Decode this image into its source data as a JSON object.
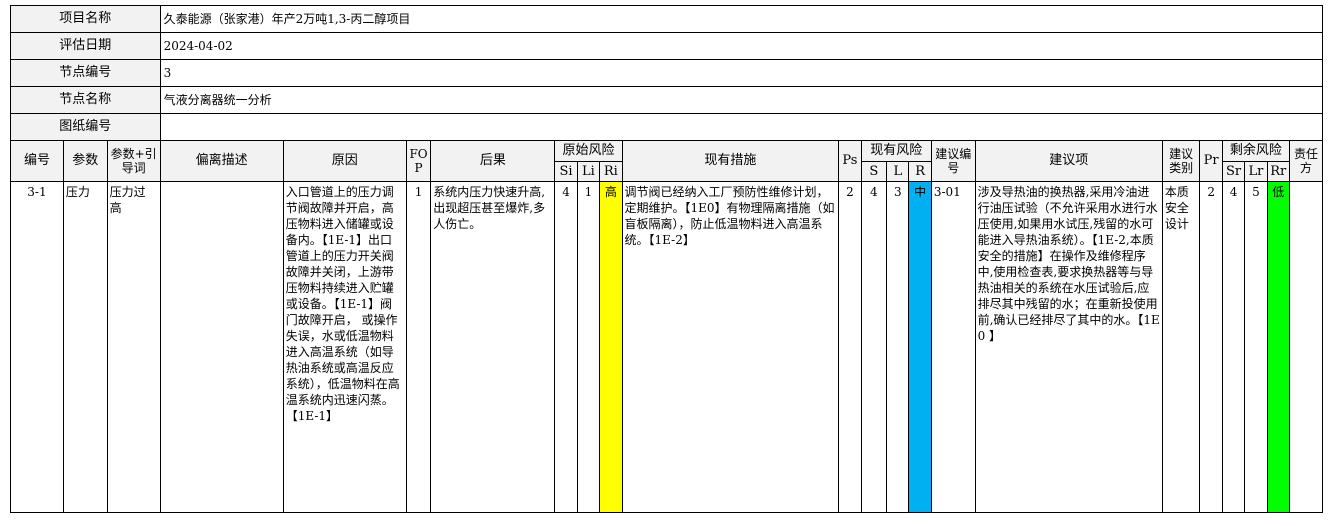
{
  "info": {
    "project_name_label": "项目名称",
    "project_name": "久泰能源（张家港）年产2万吨1,3-丙二醇项目",
    "eval_date_label": "评估日期",
    "eval_date": "2024-04-02",
    "node_no_label": "节点编号",
    "node_no": "3",
    "node_name_label": "节点名称",
    "node_name": "气液分离器统一分析",
    "drawing_no_label": "图纸编号",
    "drawing_no": ""
  },
  "headers": {
    "no": "编号",
    "param": "参数",
    "param_guide": "参数+引导词",
    "deviation": "偏离描述",
    "cause": "原因",
    "fop": "FOP",
    "consequence": "后果",
    "orig_risk": "原始风险",
    "si": "Si",
    "li": "Li",
    "ri": "Ri",
    "measures": "现有措施",
    "ps": "Ps",
    "cur_risk": "现有风险",
    "s": "S",
    "l": "L",
    "r": "R",
    "sugg_no": "建议编号",
    "sugg": "建议项",
    "sugg_type": "建议类别",
    "pr": "Pr",
    "residual_risk": "剩余风险",
    "sr": "Sr",
    "lr": "Lr",
    "rr": "Rr",
    "owner": "责任方"
  },
  "row": {
    "no": "3-1",
    "param": "压力",
    "param_guide": "压力过高",
    "deviation": "",
    "cause": "入口管道上的压力调节阀故障并开启，高压物料进入储罐或设备内。【1E-1】出口管道上的压力开关阀故障并关闭，上游带压物料持续进入贮罐或设备。【1E-1】阀门故障开启， 或操作失误，水或低温物料进入高温系统（如导热油系统或高温反应系统），低温物料在高温系统内迅速闪蒸。【1E-1】",
    "fop": "1",
    "consequence": "系统内压力快速升高,出现超压甚至爆炸,多人伤亡。",
    "si": "4",
    "li": "1",
    "ri": "高",
    "measures": "调节阀已经纳入工厂预防性维修计划，定期维护。【1E0】有物理隔离措施（如盲板隔离），防止低温物料进入高温系统。【1E-2】",
    "ps": "2",
    "s": "4",
    "l": "3",
    "r": "中",
    "sugg_no": "3-01",
    "sugg": "涉及导热油的换热器,采用冷油进行油压试验（不允许采用水进行水压使用,如果用水试压,残留的水可能进入导热油系统）。【1E-2,本质安全的措施】在操作及维修程序中,使用检查表,要求换热器等与导热油相关的系统在水压试验后,应排尽其中残留的水；在重新投使用前,确认已经排尽了其中的水。【1E0 】",
    "sugg_type": "本质安全设计",
    "pr": "2",
    "sr": "4",
    "lr": "5",
    "rr": "低",
    "owner": ""
  },
  "colors": {
    "ri": "#ffff00",
    "r": "#00b0f0",
    "rr": "#00ff00"
  }
}
